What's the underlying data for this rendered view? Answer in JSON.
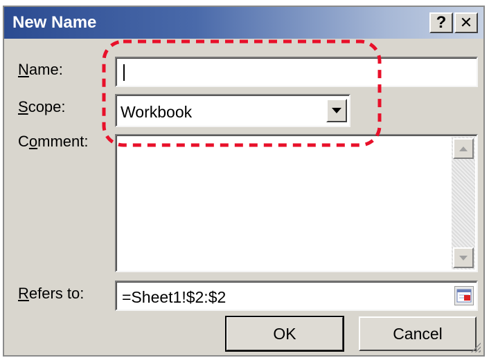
{
  "dialog": {
    "title": "New Name",
    "help_button": "?",
    "close_button": "✕"
  },
  "form": {
    "name_label_mnemonic": "N",
    "name_label_rest": "ame:",
    "name_value": "",
    "scope_label_mnemonic": "S",
    "scope_label_rest": "cope:",
    "scope_value": "Workbook",
    "comment_label_first": "C",
    "comment_label_mnemonic": "o",
    "comment_label_rest": "mment:",
    "comment_value": "",
    "refers_label_mnemonic": "R",
    "refers_label_rest": "efers to:",
    "refers_value": "=Sheet1!$2:$2"
  },
  "buttons": {
    "ok": "OK",
    "cancel": "Cancel"
  },
  "annotation": {
    "color": "#e8102a",
    "style": "dashed"
  },
  "colors": {
    "titlebar_start": "#2b4b91",
    "dialog_bg": "#d9d6ce"
  },
  "icons": [
    "help-icon",
    "close-icon",
    "dropdown-arrow-icon",
    "scroll-up-icon",
    "scroll-down-icon",
    "collapse-dialog-icon",
    "resize-grip-icon"
  ]
}
